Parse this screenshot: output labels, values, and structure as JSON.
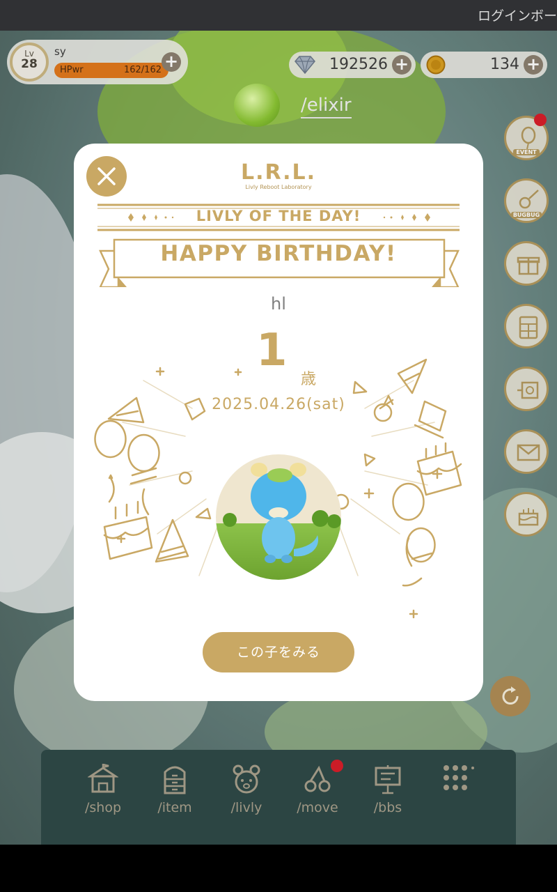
{
  "topbar": {
    "text": "ログインボー"
  },
  "player": {
    "level_label": "Lv",
    "level": "28",
    "name": "sy",
    "hp_label": "HPwr",
    "hp_value": "162/162",
    "hp_fraction": 1.0
  },
  "currency": {
    "gems": "192526",
    "coins": "134"
  },
  "map_label": "/elixir",
  "side_menu": [
    {
      "label": "EVENT",
      "icon": "balloon-icon",
      "notification": true
    },
    {
      "label": "BUGBUG",
      "icon": "bug-net-icon",
      "notification": false
    },
    {
      "label": "",
      "icon": "gift-icon",
      "notification": false
    },
    {
      "label": "",
      "icon": "calculator-icon",
      "notification": false
    },
    {
      "label": "",
      "icon": "ticket-icon",
      "notification": false
    },
    {
      "label": "",
      "icon": "mail-icon",
      "notification": false
    },
    {
      "label": "",
      "icon": "cake-icon",
      "notification": false
    }
  ],
  "modal": {
    "logo_main": "L.R.L.",
    "logo_sub": "Livly Reboot Laboratory",
    "livly_of_the_day": "LIVLY OF THE DAY!",
    "banner": "HAPPY BIRTHDAY!",
    "livly_name": "hl",
    "age": "1",
    "age_unit": "歳",
    "birthday": "2025.04.26(sat)",
    "see_button": "この子をみる"
  },
  "bottom_nav": [
    {
      "label": "/shop",
      "icon": "shop-icon",
      "notification": false
    },
    {
      "label": "/item",
      "icon": "drawer-icon",
      "notification": false
    },
    {
      "label": "/livly",
      "icon": "livly-face-icon",
      "notification": false
    },
    {
      "label": "/move",
      "icon": "move-icon",
      "notification": true
    },
    {
      "label": "/bbs",
      "icon": "signboard-icon",
      "notification": false
    },
    {
      "label": "",
      "icon": "grid-menu-icon",
      "notification": false
    }
  ],
  "colors": {
    "gold": "#c9a864",
    "notification": "#d81e2a",
    "nav_bg": "#2f4a48",
    "hp_fill": "#e2791c"
  }
}
